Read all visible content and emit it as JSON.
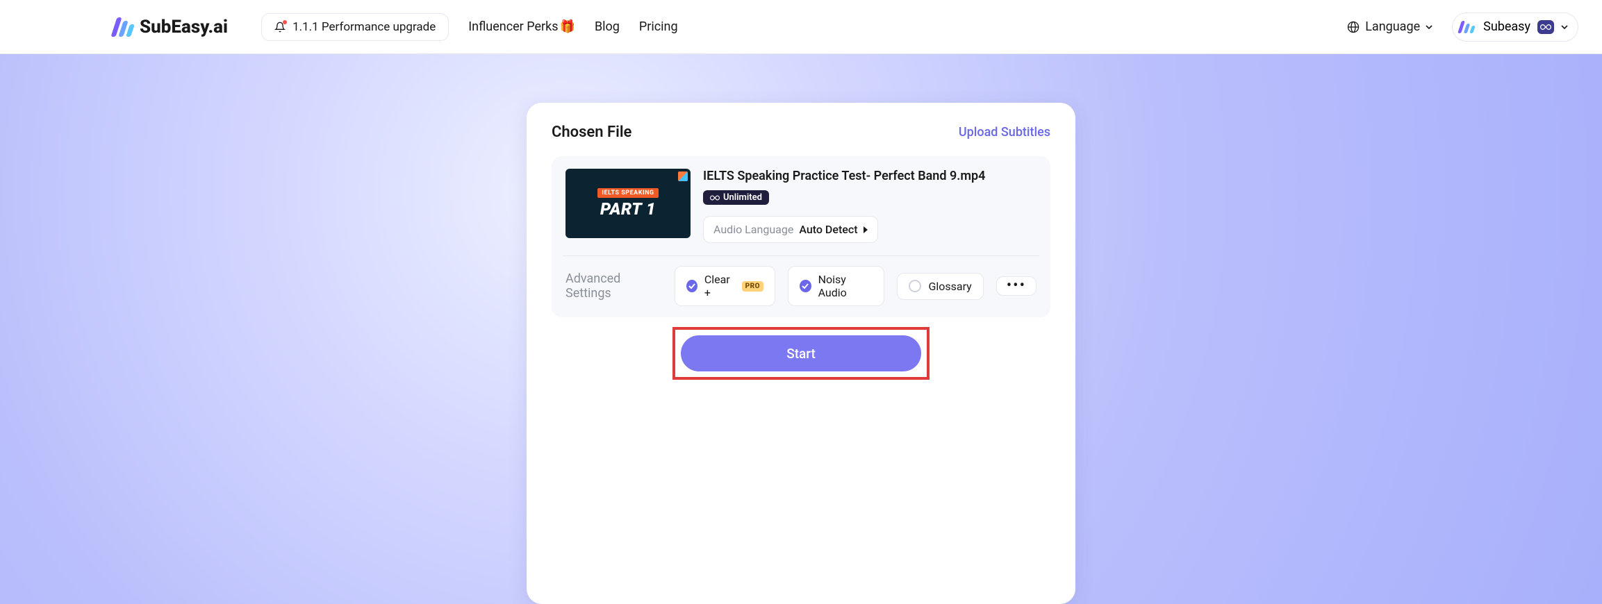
{
  "header": {
    "brand": "SubEasy.ai",
    "announcement": "1.1.1 Performance upgrade",
    "nav": {
      "perks": "Influencer Perks",
      "blog": "Blog",
      "pricing": "Pricing"
    },
    "language_label": "Language",
    "user_name": "Subeasy"
  },
  "card": {
    "title": "Chosen File",
    "upload_link": "Upload Subtitles",
    "file": {
      "name": "IELTS Speaking Practice Test- Perfect Band 9.mp4",
      "badge_text": "Unlimited",
      "thumb_tag": "IELTS SPEAKING",
      "thumb_title": "PART 1"
    },
    "audio_lang": {
      "label": "Audio Language",
      "value": "Auto Detect"
    },
    "advanced_label": "Advanced Settings",
    "options": {
      "clear": {
        "label": "Clear +",
        "checked": true,
        "pro": "PRO"
      },
      "noisy": {
        "label": "Noisy Audio",
        "checked": true
      },
      "glossary": {
        "label": "Glossary",
        "checked": false
      }
    },
    "start_label": "Start"
  }
}
